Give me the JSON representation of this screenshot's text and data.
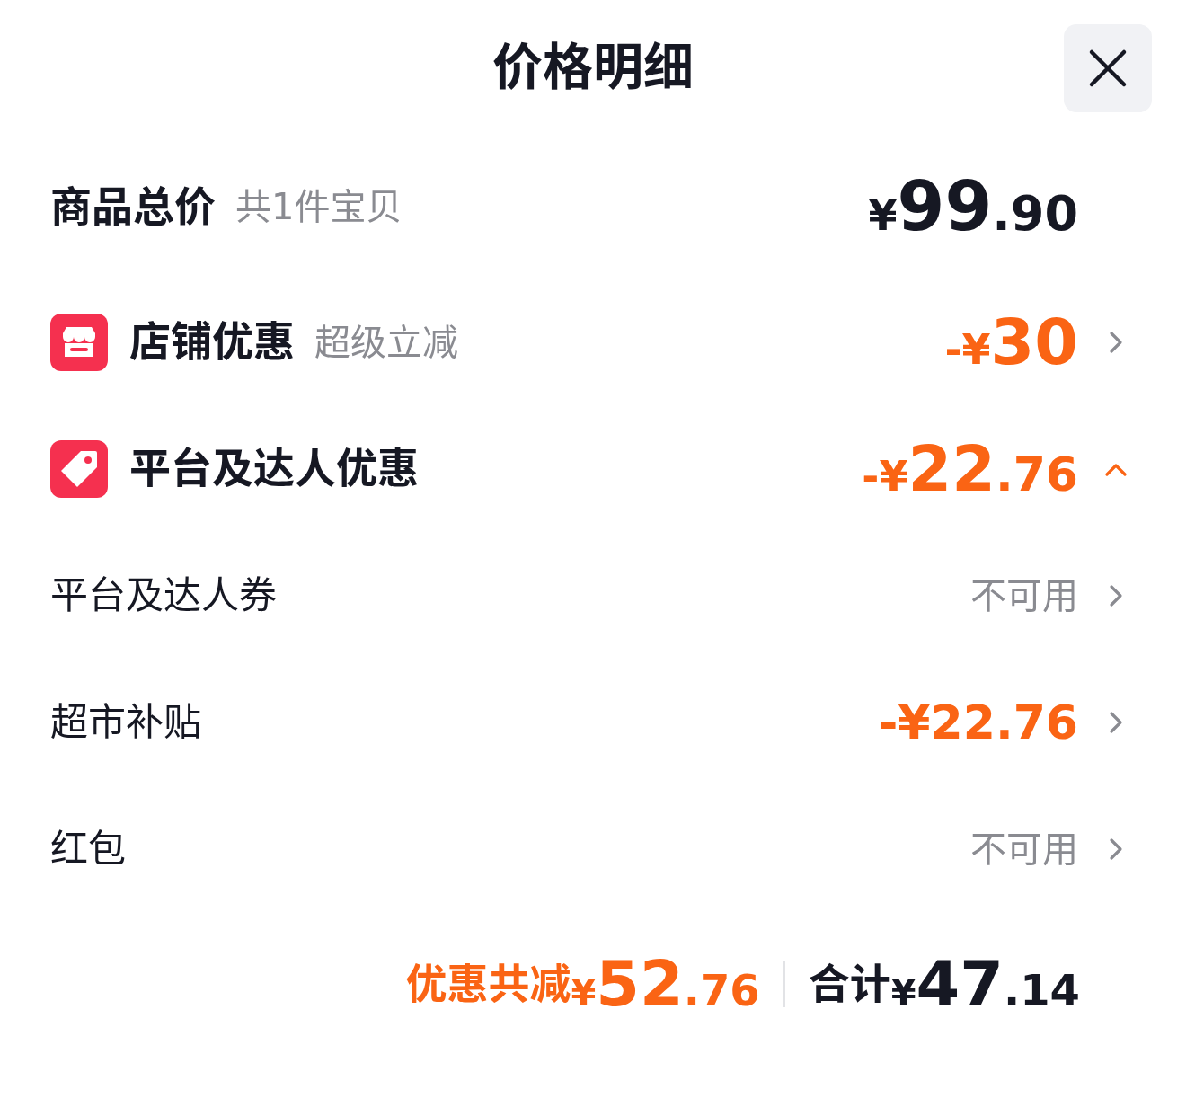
{
  "title": "价格明细",
  "total": {
    "label": "商品总价",
    "note": "共1件宝贝",
    "amount": "¥99.90"
  },
  "discounts": [
    {
      "kind": "shop",
      "label": "店铺优惠",
      "note": "超级立减",
      "amount": "-¥30",
      "expanded": false
    },
    {
      "kind": "platform",
      "label": "平台及达人优惠",
      "amount": "-¥22.76",
      "expanded": true,
      "children": [
        {
          "label": "平台及达人券",
          "kind": "status",
          "value": "不可用"
        },
        {
          "label": "超市补贴",
          "kind": "amount",
          "value": "-¥22.76"
        },
        {
          "label": "红包",
          "kind": "status",
          "value": "不可用"
        }
      ]
    }
  ],
  "footer": {
    "discount_label": "优惠共减",
    "discount_amount": "¥52.76",
    "total_label": "合计",
    "total_amount": "¥47.14"
  }
}
